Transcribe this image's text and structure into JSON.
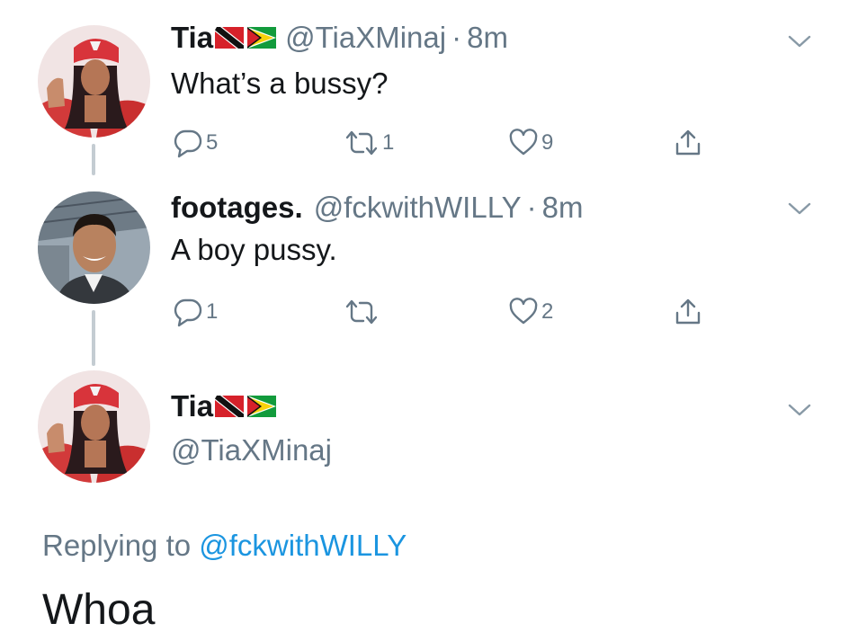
{
  "tweets": [
    {
      "display_name": "Tia",
      "flags": [
        "trinidad-and-tobago-flag",
        "guyana-flag"
      ],
      "handle": "@TiaXMinaj",
      "separator": "·",
      "time": "8m",
      "text": "What’s a bussy?",
      "actions": {
        "replies": "5",
        "retweets": "1",
        "likes": "9"
      }
    },
    {
      "display_name": "footages.",
      "handle": "@fckwithWILLY",
      "separator": "·",
      "time": "8m",
      "text": "A boy pussy.",
      "actions": {
        "replies": "1",
        "retweets": "",
        "likes": "2"
      }
    }
  ],
  "main_tweet": {
    "display_name": "Tia",
    "flags": [
      "trinidad-and-tobago-flag",
      "guyana-flag"
    ],
    "handle": "@TiaXMinaj",
    "replying_prefix": "Replying to ",
    "replying_to": "@fckwithWILLY",
    "text": "Whoa"
  },
  "icons": {
    "reply": "reply-icon",
    "retweet": "retweet-icon",
    "like": "heart-icon",
    "share": "share-icon",
    "menu": "chevron-down-icon"
  },
  "colors": {
    "text_primary": "#14171a",
    "text_secondary": "#657786",
    "link": "#1b95e0",
    "thread_line": "#c4ccd2"
  }
}
